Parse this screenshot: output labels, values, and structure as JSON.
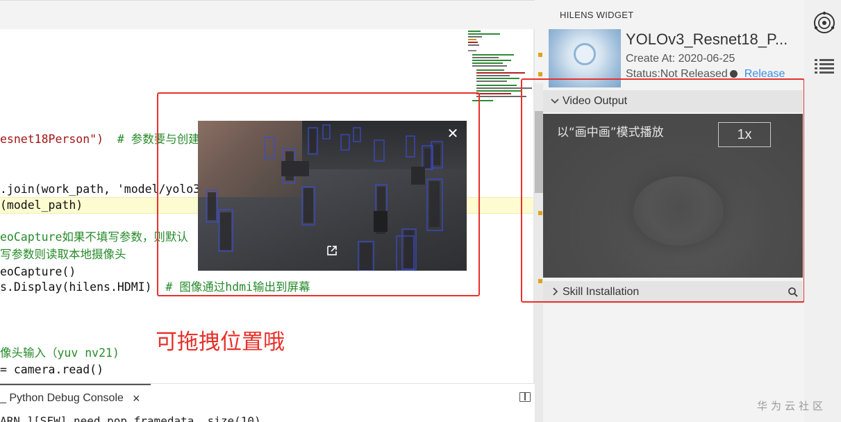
{
  "editor": {
    "lines": [
      {
        "prefix": "",
        "code": "esnet18Person\")",
        "comment": "  # 参数要与创建"
      },
      {
        "prefix": "",
        "code": ".join(work_path, 'model/yolo3_",
        "comment": ""
      },
      {
        "prefix": "",
        "code": "(model_path)",
        "comment": ""
      },
      {
        "prefix": "",
        "code": "",
        "comment": "eoCapture如果不填写参数，则默认"
      },
      {
        "prefix": "",
        "code": "",
        "comment": "写参数则读取本地摄像头"
      },
      {
        "prefix": "",
        "code": "eoCapture()",
        "comment": ""
      },
      {
        "prefix": "",
        "code": "s.Display(hilens.HDMI)",
        "comment": "  # 图像通过hdmi输出到屏幕"
      },
      {
        "prefix": "",
        "code": "",
        "comment": "像头输入（yuv nv21)"
      },
      {
        "prefix": "",
        "code": "= camera.read()",
        "comment": ""
      }
    ],
    "drag_note": "可拖拽位置哦"
  },
  "console": {
    "tab_label": "_ Python Debug Console",
    "close_glyph": "×",
    "output": "ARN ][SFW] need pop framedata, size(10)"
  },
  "panel": {
    "title": "HILENS WIDGET",
    "model_name": "YOLOv3_Resnet18_P...",
    "created": "Create At: 2020-06-25",
    "status_label": "Status:Not Released",
    "release_label": "Release",
    "video_section": "Video Output",
    "video_caption": "以“画中画”模式播放",
    "speed": "1x",
    "skill_section": "Skill Installation"
  },
  "pip": {
    "close_glyph": "✕"
  },
  "watermark": "华为云社区",
  "colors": {
    "highlight_red": "#e8302a",
    "link_blue": "#3a8ee6",
    "marker_orange": "#e0a21c"
  },
  "icons": [
    "hilens-widget-icon",
    "list-icon",
    "close-icon",
    "expand-icon",
    "chevron-down-icon",
    "chevron-right-icon",
    "search-icon",
    "split-editor-icon"
  ]
}
